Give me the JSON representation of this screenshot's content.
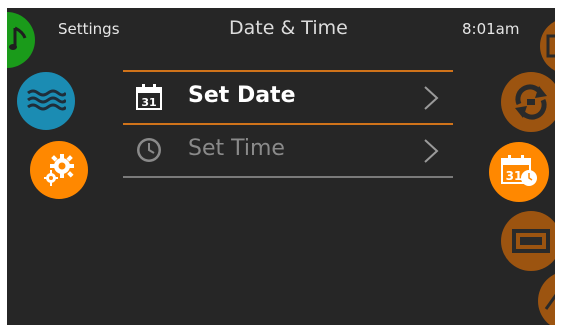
{
  "header": {
    "section_label": "Settings",
    "title": "Date & Time",
    "clock": "8:01am"
  },
  "menu": {
    "items": [
      {
        "label": "Set Date",
        "icon": "calendar-31-icon",
        "icon_text": "31",
        "enabled": true
      },
      {
        "label": "Set Time",
        "icon": "clock-icon",
        "enabled": false
      }
    ]
  },
  "left_nav": [
    {
      "name": "music-icon",
      "color": "#1a9b1a"
    },
    {
      "name": "water-waves-icon",
      "color": "#1b8cb3"
    },
    {
      "name": "settings-gears-icon",
      "color": "#ff8800"
    }
  ],
  "right_nav": [
    {
      "name": "calendar-icon",
      "color": "#9c5410"
    },
    {
      "name": "refresh-cycle-icon",
      "color": "#9c5410"
    },
    {
      "name": "date-time-icon",
      "color": "#ff8800",
      "text": "31"
    },
    {
      "name": "display-screen-icon",
      "color": "#9c5410"
    },
    {
      "name": "arrow-icon",
      "color": "#9c5410"
    }
  ],
  "colors": {
    "background": "#262626",
    "accent": "#ff8800",
    "inactive_accent": "#9c5410",
    "active_text": "#ffffff",
    "disabled_text": "#8a8a8a",
    "separator": "#7a7a7a"
  }
}
